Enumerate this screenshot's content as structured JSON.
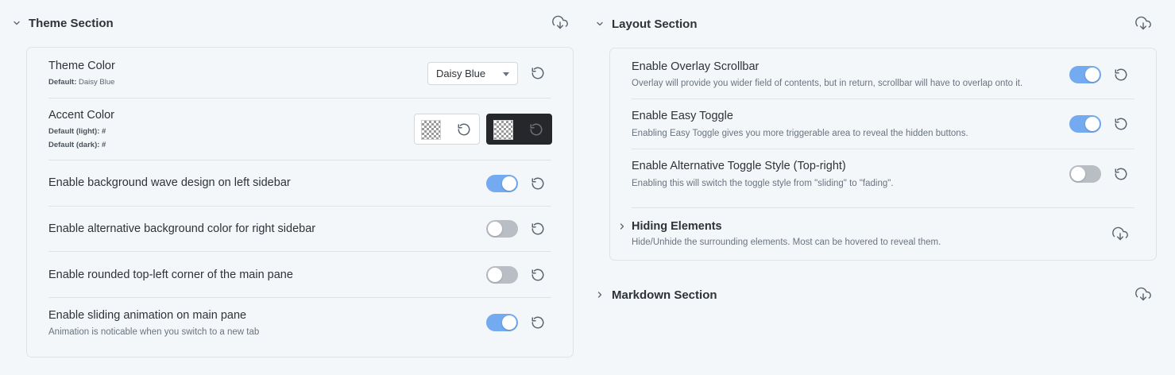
{
  "theme_section": {
    "title": "Theme Section",
    "theme_color": {
      "name": "Theme Color",
      "default_label": "Default:",
      "default_value": "Daisy Blue",
      "selected": "Daisy Blue"
    },
    "accent_color": {
      "name": "Accent Color",
      "default_light_label": "Default (light):",
      "default_light_value": "#",
      "default_dark_label": "Default (dark):",
      "default_dark_value": "#"
    },
    "settings": [
      {
        "name": "Enable background wave design on left sidebar",
        "desc": "",
        "enabled": true
      },
      {
        "name": "Enable alternative background color for right sidebar",
        "desc": "",
        "enabled": false
      },
      {
        "name": "Enable rounded top-left corner of the main pane",
        "desc": "",
        "enabled": false
      },
      {
        "name": "Enable sliding animation on main pane",
        "desc": "Animation is noticable when you switch to a new tab",
        "enabled": true
      }
    ]
  },
  "layout_section": {
    "title": "Layout Section",
    "settings": [
      {
        "name": "Enable Overlay Scrollbar",
        "desc": "Overlay will provide you wider field of contents, but in return, scrollbar will have to overlap onto it.",
        "enabled": true
      },
      {
        "name": "Enable Easy Toggle",
        "desc": "Enabling Easy Toggle gives you more triggerable area to reveal the hidden buttons.",
        "enabled": true
      },
      {
        "name": "Enable Alternative Toggle Style (Top-right)",
        "desc": "Enabling this will switch the toggle style from \"sliding\" to \"fading\".",
        "enabled": false
      }
    ],
    "hiding_elements": {
      "name": "Hiding Elements",
      "desc": "Hide/Unhide the surrounding elements. Most can be hovered to reveal them."
    }
  },
  "markdown_section": {
    "title": "Markdown Section"
  },
  "colors": {
    "accent": "#74aaf0",
    "toggle_off": "#b9bec5",
    "background": "#f4f7fa",
    "border": "#dfe3e8"
  },
  "icons": [
    "chevron-down-icon",
    "chevron-right-icon",
    "download-cloud-icon",
    "reset-icon"
  ]
}
